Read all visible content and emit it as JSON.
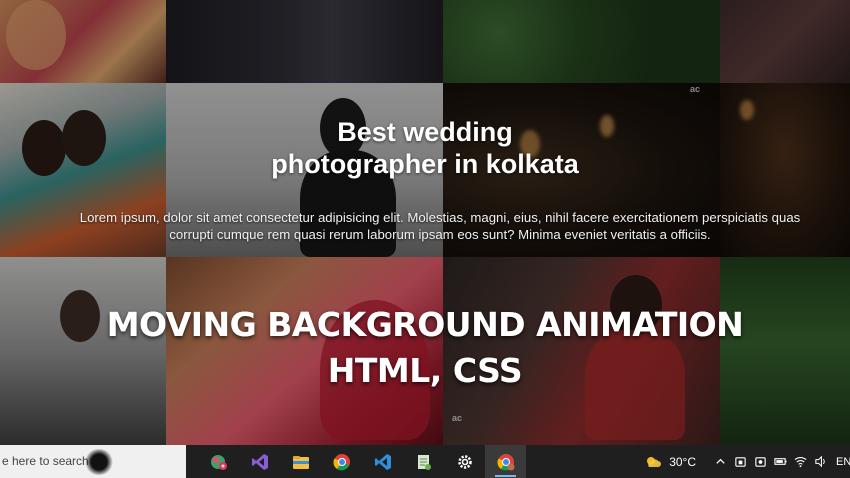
{
  "hero": {
    "headline_line1": "Best wedding",
    "headline_line2": "photographer in kolkata",
    "description": "Lorem ipsum, dolor sit amet consectetur adipisicing elit. Molestias, magni, eius, nihil facere exercitationem perspiciatis quas corrupti cumque rem quasi rerum laborum ipsam eos sunt? Minima eveniet veritatis a officiis.",
    "title_line1": "MOVING BACKGROUND ANIMATION",
    "title_line2": "HTML, CSS",
    "watermark_logo": "ac"
  },
  "taskbar": {
    "search_placeholder": "e here to search",
    "apps": [
      {
        "name": "app-icon",
        "running": false,
        "active": false
      },
      {
        "name": "visual-studio-icon",
        "running": false,
        "active": false
      },
      {
        "name": "file-explorer-icon",
        "running": false,
        "active": false
      },
      {
        "name": "chrome-icon",
        "running": false,
        "active": false
      },
      {
        "name": "vscode-icon",
        "running": false,
        "active": false
      },
      {
        "name": "notepad-plus-icon",
        "running": false,
        "active": false
      },
      {
        "name": "settings-icon",
        "running": false,
        "active": false
      },
      {
        "name": "chrome-profile-icon",
        "running": true,
        "active": true
      }
    ],
    "weather_temp": "30°C",
    "language": "EN"
  }
}
